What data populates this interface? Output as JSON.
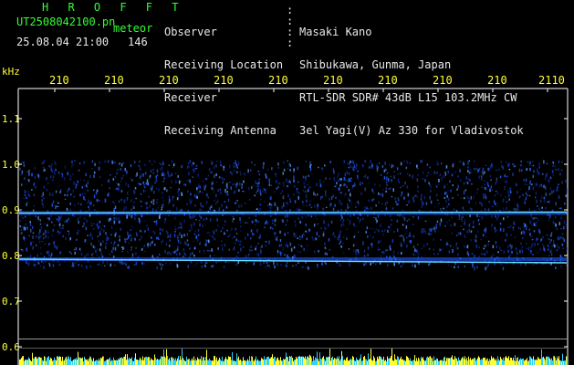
{
  "header": {
    "station": "H R O F F T",
    "filename": "UT2508042100.pn",
    "meteor_label": "meteor",
    "datetime": "25.08.04 21:00",
    "meteor_count": "146",
    "fields": [
      {
        "label": "Observer",
        "value": "Masaki Kano"
      },
      {
        "label": "Receiving Location",
        "value": "Shibukawa, Gunma, Japan"
      },
      {
        "label": "Receiver",
        "value": "RTL-SDR SDR# 43dB L15 103.2MHz CW"
      },
      {
        "label": "Receiving Antenna",
        "value": "3el Yagi(V) Az 330 for Vladivostok"
      }
    ]
  },
  "colors": {
    "text_green": "#33ff33",
    "text_white": "#e8e8e8",
    "axis_yellow": "#ffff33",
    "signal_blue": "#1e5aff",
    "trace_cyan": "#66e0ff",
    "background": "#000000"
  },
  "chart_data": {
    "type": "heatmap",
    "ylabel": "kHz",
    "yticks": [
      "1.1",
      "1.0",
      "0.9",
      "0.8",
      "0.7",
      "0.6"
    ],
    "ytick_values": [
      1.1,
      1.0,
      0.9,
      0.8,
      0.7,
      0.6
    ],
    "ylim": [
      0.59,
      1.16
    ],
    "xticks": [
      "210",
      "210",
      "210",
      "210",
      "210",
      "210",
      "210",
      "210",
      "210",
      "2110"
    ],
    "xlim": [
      0,
      10
    ],
    "noise_band": [
      0.775,
      1.01
    ],
    "carrier_traces": [
      0.893,
      0.792
    ],
    "reference_line": 0.617
  }
}
